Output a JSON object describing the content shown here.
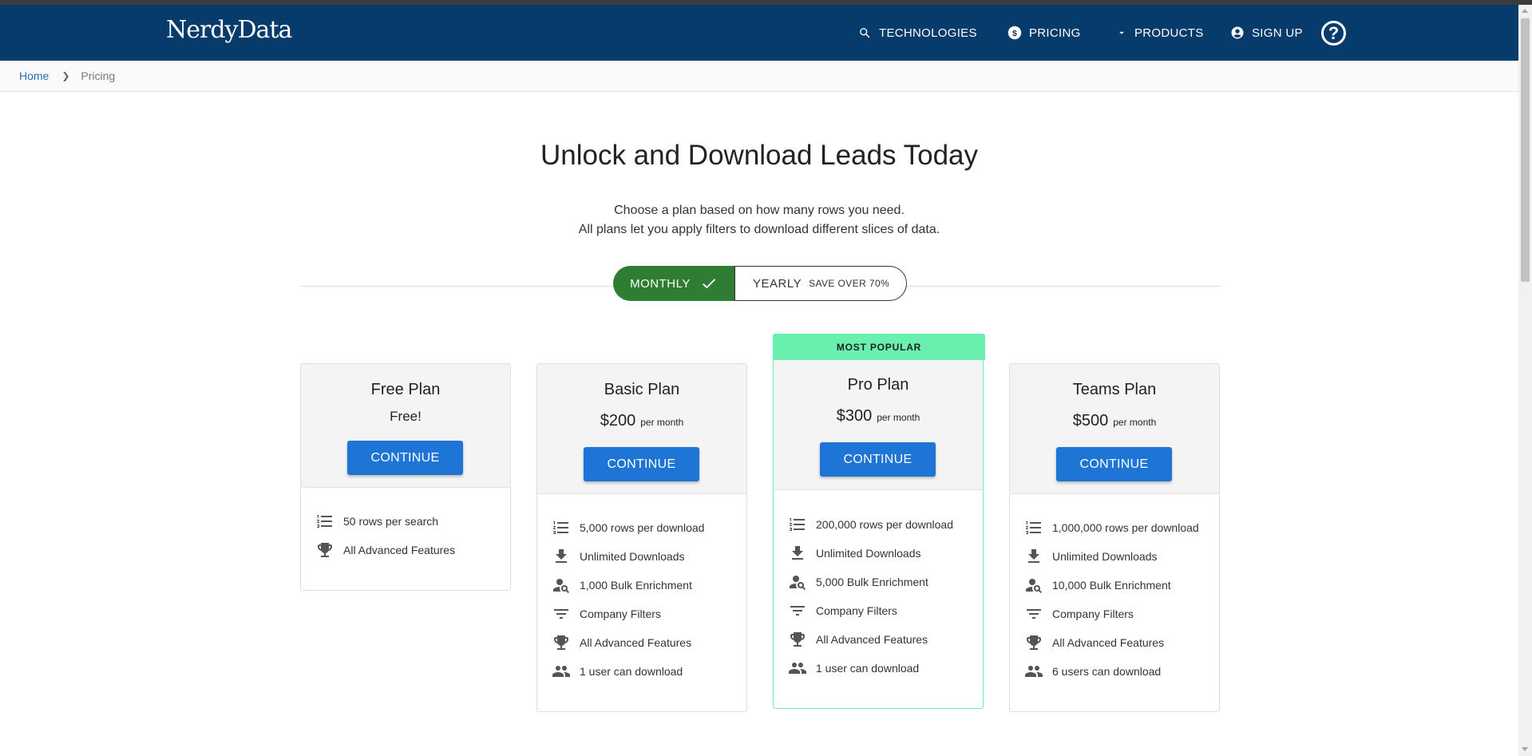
{
  "header": {
    "logo": "NerdyData",
    "nav": {
      "technologies": "TECHNOLOGIES",
      "pricing": "PRICING",
      "products": "PRODUCTS",
      "signup": "SIGN UP"
    },
    "help_glyph": "?"
  },
  "breadcrumb": {
    "home": "Home",
    "current": "Pricing"
  },
  "hero": {
    "title": "Unlock and Download Leads Today",
    "line1": "Choose a plan based on how many rows you need.",
    "line2": "All plans let you apply filters to download different slices of data."
  },
  "billing_toggle": {
    "monthly": "MONTHLY",
    "yearly": "YEARLY",
    "yearly_note": "SAVE OVER 70%",
    "selected": "monthly"
  },
  "plans": [
    {
      "name": "Free Plan",
      "price": "Free!",
      "period": "",
      "button": "CONTINUE",
      "features": [
        {
          "icon": "list-numbered-icon",
          "text": "50 rows per search"
        },
        {
          "icon": "trophy-icon",
          "text": "All Advanced Features"
        }
      ]
    },
    {
      "name": "Basic Plan",
      "price": "$200",
      "period": "per month",
      "button": "CONTINUE",
      "features": [
        {
          "icon": "list-numbered-icon",
          "text": "5,000 rows per download"
        },
        {
          "icon": "download-icon",
          "text": "Unlimited Downloads"
        },
        {
          "icon": "person-search-icon",
          "text": "1,000 Bulk Enrichment"
        },
        {
          "icon": "filter-icon",
          "text": "Company Filters"
        },
        {
          "icon": "trophy-icon",
          "text": "All Advanced Features"
        },
        {
          "icon": "people-icon",
          "text": "1 user can download"
        }
      ]
    },
    {
      "name": "Pro Plan",
      "badge": "MOST POPULAR",
      "price": "$300",
      "period": "per month",
      "button": "CONTINUE",
      "features": [
        {
          "icon": "list-numbered-icon",
          "text": "200,000 rows per download"
        },
        {
          "icon": "download-icon",
          "text": "Unlimited Downloads"
        },
        {
          "icon": "person-search-icon",
          "text": "5,000 Bulk Enrichment"
        },
        {
          "icon": "filter-icon",
          "text": "Company Filters"
        },
        {
          "icon": "trophy-icon",
          "text": "All Advanced Features"
        },
        {
          "icon": "people-icon",
          "text": "1 user can download"
        }
      ]
    },
    {
      "name": "Teams Plan",
      "price": "$500",
      "period": "per month",
      "button": "CONTINUE",
      "features": [
        {
          "icon": "list-numbered-icon",
          "text": "1,000,000 rows per download"
        },
        {
          "icon": "download-icon",
          "text": "Unlimited Downloads"
        },
        {
          "icon": "person-search-icon",
          "text": "10,000 Bulk Enrichment"
        },
        {
          "icon": "filter-icon",
          "text": "Company Filters"
        },
        {
          "icon": "trophy-icon",
          "text": "All Advanced Features"
        },
        {
          "icon": "people-icon",
          "text": "6 users can download"
        }
      ]
    }
  ],
  "colors": {
    "navbar": "#063b6b",
    "accent_button": "#1f75d6",
    "toggle_selected": "#2e7d32",
    "popular_band": "#69f0ae"
  }
}
